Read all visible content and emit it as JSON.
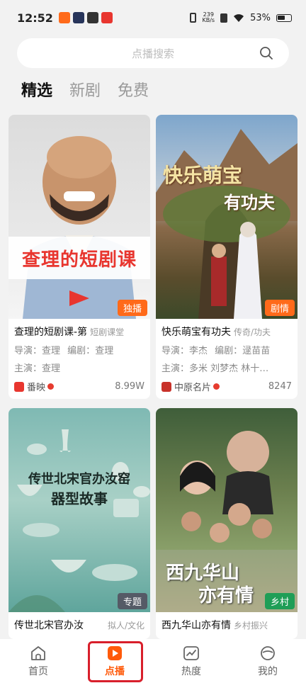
{
  "status_bar": {
    "time": "12:52",
    "net_speed_value": "239",
    "net_speed_unit": "KB/s",
    "battery": "53%"
  },
  "search": {
    "placeholder": "点播搜索"
  },
  "tabs": [
    {
      "label": "精选",
      "active": true
    },
    {
      "label": "新剧",
      "active": false
    },
    {
      "label": "免费",
      "active": false
    }
  ],
  "cards": [
    {
      "title": "查理的短剧课-第",
      "genre": "短剧课堂",
      "badge": "独播",
      "poster_text": "查理的短剧课",
      "director_label": "导演：",
      "director": "查理",
      "writer_label": "编剧：",
      "writer": "查理",
      "cast_label": "主演：",
      "cast": "查理",
      "provider": "番映",
      "count": "8.99W"
    },
    {
      "title": "快乐萌宝有功夫",
      "genre": "传奇/功夫",
      "badge": "剧情",
      "poster_text_1": "快乐萌宝",
      "poster_text_2": "有功夫",
      "director_label": "导演：",
      "director": "李杰",
      "writer_label": "编剧：",
      "writer": "逯苗苗",
      "cast_label": "主演：",
      "cast": "多米 刘梦杰 林十…",
      "provider": "中原名片",
      "count": "8247"
    },
    {
      "title": "传世北宋官办汝",
      "genre": "拟人/文化",
      "badge": "专题",
      "poster_text_1": "传世北宋官办汝窑",
      "poster_text_2": "器型故事"
    },
    {
      "title": "西九华山亦有情",
      "genre": "乡村振兴",
      "badge": "乡村",
      "poster_text_1": "西九华山",
      "poster_text_2": "亦有情"
    }
  ],
  "bottom_nav": [
    {
      "label": "首页",
      "icon": "home-icon"
    },
    {
      "label": "点播",
      "icon": "play-icon",
      "active": true
    },
    {
      "label": "热度",
      "icon": "trend-icon"
    },
    {
      "label": "我的",
      "icon": "profile-icon"
    }
  ],
  "colors": {
    "accent": "#ff5a0a",
    "highlight_box": "#d81f2b"
  }
}
